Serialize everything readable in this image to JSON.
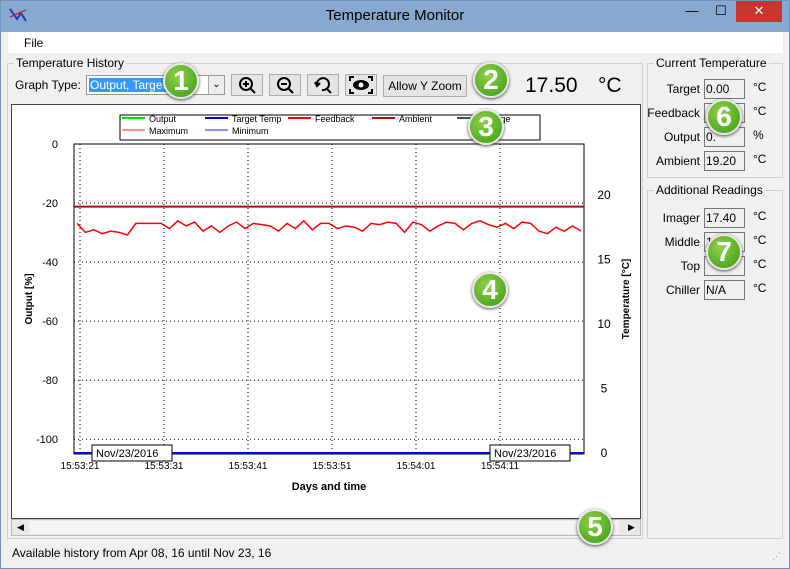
{
  "window": {
    "title": "Temperature Monitor",
    "minimize": "—",
    "maximize": "☐",
    "close": "✕"
  },
  "menu": {
    "file": "File"
  },
  "history": {
    "group_label": "Temperature History",
    "graph_type_label": "Graph Type:",
    "graph_type_value": "Output, Target T...e",
    "allow_y_zoom": "Allow Y Zoom",
    "current_value": "17.50",
    "unit": "°C"
  },
  "current": {
    "group_label": "Current Temperature",
    "rows": [
      {
        "label": "Target",
        "value": "0.00",
        "unit": "°C"
      },
      {
        "label": "Feedback",
        "value": "",
        "unit": "°C"
      },
      {
        "label": "Output",
        "value": "0.",
        "unit": "%"
      },
      {
        "label": "Ambient",
        "value": "19.20",
        "unit": "°C"
      }
    ]
  },
  "additional": {
    "group_label": "Additional Readings",
    "rows": [
      {
        "label": "Imager",
        "value": "17.40",
        "unit": "°C"
      },
      {
        "label": "Middle",
        "value": "1",
        "unit": "°C"
      },
      {
        "label": "Top",
        "value": "",
        "unit": "°C"
      },
      {
        "label": "Chiller",
        "value": "N/A",
        "unit": "°C"
      }
    ]
  },
  "badges": [
    "1",
    "2",
    "3",
    "4",
    "5",
    "6",
    "7"
  ],
  "status": "Available history from Apr 08, 16 until Nov 23, 16",
  "colors": {
    "output": "#00e000",
    "target": "#0000ff",
    "feedback": "#ff0000",
    "ambient": "#a01010",
    "range": "#207020",
    "maximum": "#ff2020",
    "minimum": "#2020ff"
  },
  "chart_data": {
    "type": "line",
    "xlabel": "Days and time",
    "ylabel_left": "Output [%]",
    "ylabel_right": "Temperature [°C]",
    "x_ticks": [
      "15:53:21",
      "15:53:31",
      "15:53:41",
      "15:53:51",
      "15:54:01",
      "15:54:11"
    ],
    "left_ticks": [
      "0",
      "-20",
      "-40",
      "-60",
      "-80",
      "-100"
    ],
    "left_range": [
      -105,
      0
    ],
    "right_ticks": [
      "0",
      "5",
      "10",
      "15",
      "20"
    ],
    "right_range": [
      0,
      24
    ],
    "date_left": "Nov/23/2016",
    "date_right": "Nov/23/2016",
    "legend": [
      "Output",
      "Target Temp",
      "Feedback",
      "Ambient",
      "Range",
      "Maximum",
      "Minimum"
    ],
    "series": [
      {
        "name": "Ambient",
        "axis": "right",
        "constant": 19.1
      },
      {
        "name": "Target Temp",
        "axis": "right",
        "constant": 0
      },
      {
        "name": "Feedback",
        "axis": "right",
        "values": [
          17.8,
          17.1,
          17.3,
          17.0,
          17.2,
          17.1,
          16.9,
          17.8,
          17.8,
          17.8,
          17.8,
          17.4,
          18.0,
          17.6,
          17.9,
          17.2,
          17.6,
          17.1,
          17.6,
          17.9,
          17.4,
          17.8,
          17.7,
          17.6,
          17.2,
          17.8,
          17.4,
          18.0,
          17.3,
          17.8,
          17.8,
          17.4,
          17.6,
          17.5,
          17.2,
          17.8,
          17.7,
          17.9,
          17.8,
          17.1,
          17.9,
          17.7,
          17.2,
          17.6,
          17.9,
          17.8,
          17.3,
          17.8,
          18.0,
          17.7,
          17.5,
          17.8,
          17.4,
          17.9,
          17.8,
          17.2,
          17.0,
          17.5,
          17.2,
          17.6,
          17.2
        ]
      }
    ]
  }
}
